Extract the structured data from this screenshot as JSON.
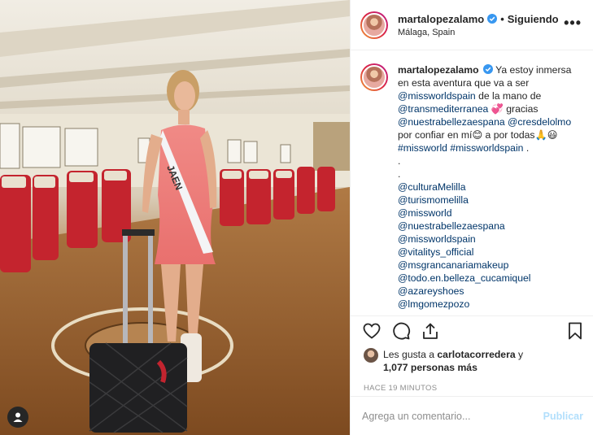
{
  "post": {
    "username": "martalopezalamo",
    "follow_separator": "•",
    "follow_status": "Siguiendo",
    "location": "Málaga, Spain",
    "more_label": "•••",
    "sash_text": "JAEN"
  },
  "caption": {
    "username": "martalopezalamo",
    "lines": [
      {
        "pre": "Ya estoy inmersa"
      },
      {
        "text": "en esta aventura que va a ser"
      },
      {
        "tag": "@missworldspain",
        "text": " de la mano de"
      },
      {
        "tag": "@transmediterranea",
        "text": " 💞 gracias"
      },
      {
        "tag": "@nuestrabellezaespana",
        "tag2": "@cresdelolmo"
      },
      {
        "text": "por confiar en mí😊 a por todas🙏😃"
      },
      {
        "tag": "#missworld",
        "tag2": "#missworldspain",
        "text2": " ."
      },
      {
        "text": "."
      },
      {
        "text": "."
      },
      {
        "tag": "@culturaMelilla"
      },
      {
        "tag": "@turismomelilla"
      },
      {
        "tag": "@missworld"
      },
      {
        "tag": "@nuestrabellezaespana"
      },
      {
        "tag": "@missworldspain"
      },
      {
        "tag": "@vitalitys_official"
      },
      {
        "tag": "@msgrancanariamakeup"
      },
      {
        "tag": "@todo.en.belleza_cucamiquel"
      },
      {
        "tag": "@azareyshoes"
      },
      {
        "tag": "@lmgomezpozo"
      }
    ]
  },
  "likes": {
    "prefix": "Les gusta a ",
    "user": "carlotacorredera",
    "connector": " y",
    "count": "1,077 personas más"
  },
  "timestamp": "HACE 19 MINUTOS",
  "comment": {
    "placeholder": "Agrega un comentario...",
    "publish_label": "Publicar"
  },
  "colors": {
    "link": "#003569",
    "verified": "#3897f0",
    "publish_disabled": "#b2dffc",
    "muted": "#8e8e8e"
  },
  "icons": [
    "verified-badge-icon",
    "more-options-icon",
    "heart-icon",
    "comment-icon",
    "share-icon",
    "bookmark-icon",
    "user-tag-icon"
  ]
}
